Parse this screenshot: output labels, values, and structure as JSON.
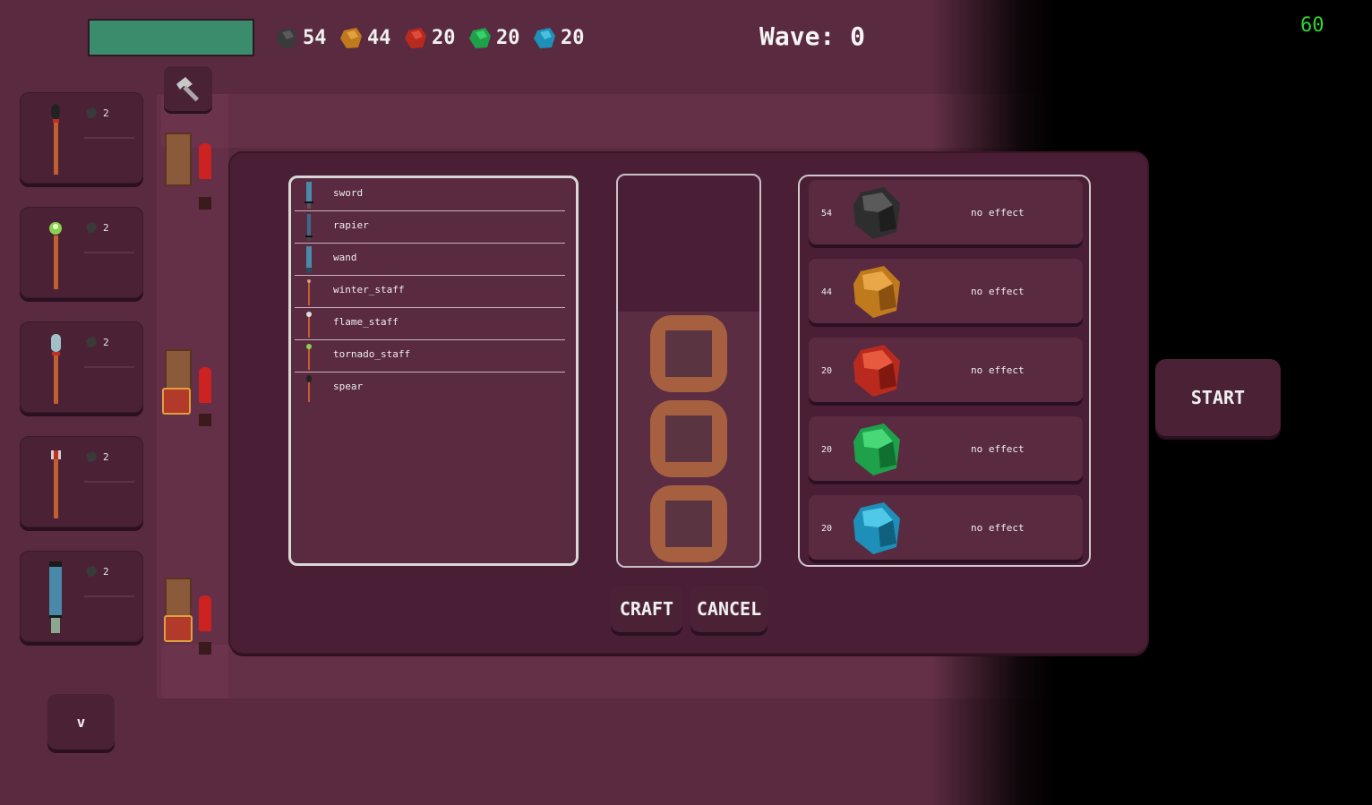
{
  "hud": {
    "fps": "60",
    "wave_label": "Wave: 0",
    "resources": [
      {
        "icon": "black-gem-icon",
        "count": "54",
        "color": "#3a3a3a"
      },
      {
        "icon": "amber-gem-icon",
        "count": "44",
        "color": "#c07a1e"
      },
      {
        "icon": "red-gem-icon",
        "count": "20",
        "color": "#b82a1e"
      },
      {
        "icon": "green-gem-icon",
        "count": "20",
        "color": "#1fa04a"
      },
      {
        "icon": "blue-gem-icon",
        "count": "20",
        "color": "#1e8fb8"
      }
    ],
    "health_color": "#3a8c6c"
  },
  "weapon_cards": [
    {
      "icon": "spear-icon",
      "cost": "2"
    },
    {
      "icon": "tornado-staff-icon",
      "cost": "2"
    },
    {
      "icon": "winter-staff-icon",
      "cost": "2"
    },
    {
      "icon": "flame-staff-icon",
      "cost": "2"
    },
    {
      "icon": "sword-icon",
      "cost": "2"
    }
  ],
  "more_button": "v",
  "recipes": [
    {
      "name": "sword",
      "icon": "sword-icon"
    },
    {
      "name": "rapier",
      "icon": "rapier-icon"
    },
    {
      "name": "wand",
      "icon": "wand-icon"
    },
    {
      "name": "winter_staff",
      "icon": "winter-staff-icon"
    },
    {
      "name": "flame_staff",
      "icon": "flame-staff-icon"
    },
    {
      "name": "tornado_staff",
      "icon": "tornado-staff-icon"
    },
    {
      "name": "spear",
      "icon": "spear-icon"
    }
  ],
  "buttons": {
    "craft": "CRAFT",
    "cancel": "CANCEL",
    "start": "START"
  },
  "gems": [
    {
      "count": "54",
      "effect": "no effect",
      "color": "#3a3a3a"
    },
    {
      "count": "44",
      "effect": "no effect",
      "color": "#c07a1e"
    },
    {
      "count": "20",
      "effect": "no effect",
      "color": "#b82a1e"
    },
    {
      "count": "20",
      "effect": "no effect",
      "color": "#1fa04a"
    },
    {
      "count": "20",
      "effect": "no effect",
      "color": "#1e8fb8"
    }
  ]
}
